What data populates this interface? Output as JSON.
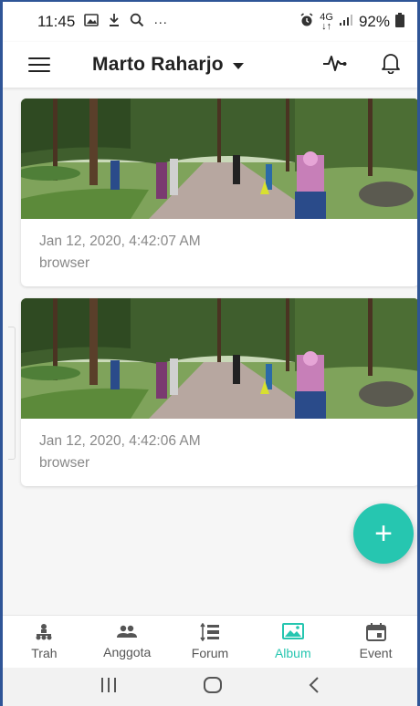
{
  "status": {
    "time": "11:45",
    "icons_left": [
      "image-icon",
      "download-icon",
      "search-icon",
      "more-icon"
    ],
    "more": "···",
    "net_top": "4G",
    "net_bottom": "↓↑",
    "battery": "92%"
  },
  "appbar": {
    "title": "Marto Raharjo"
  },
  "album": {
    "items": [
      {
        "date": "Jan 12, 2020, 4:42:07 AM",
        "source": "browser"
      },
      {
        "date": "Jan 12, 2020, 4:42:06 AM",
        "source": "browser"
      }
    ]
  },
  "fab": {
    "label": "+"
  },
  "nav": {
    "items": [
      {
        "label": "Trah",
        "icon": "family-tree-icon"
      },
      {
        "label": "Anggota",
        "icon": "group-icon"
      },
      {
        "label": "Forum",
        "icon": "forum-icon"
      },
      {
        "label": "Album",
        "icon": "album-icon"
      },
      {
        "label": "Event",
        "icon": "calendar-icon"
      }
    ],
    "active": "Album"
  },
  "colors": {
    "accent": "#26c6b0",
    "frame": "#2f5597",
    "text_muted": "#888888"
  }
}
